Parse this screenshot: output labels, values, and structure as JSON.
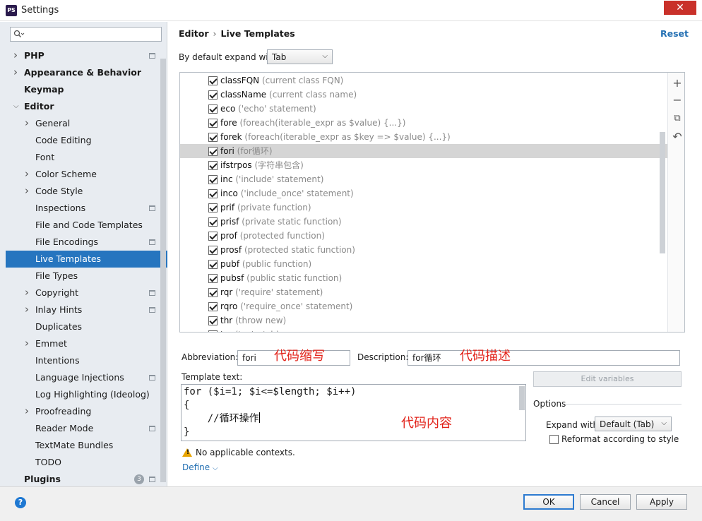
{
  "window": {
    "title": "Settings",
    "app_icon": "PS",
    "close_glyph": "✕"
  },
  "search": {
    "value": ""
  },
  "sidebar": {
    "items": [
      {
        "label": "PHP",
        "bold": true,
        "chev": true,
        "indent": 0,
        "proj": true
      },
      {
        "label": "Appearance & Behavior",
        "bold": true,
        "chev": true,
        "indent": 0
      },
      {
        "label": "Keymap",
        "bold": true,
        "chev": false,
        "indent": 0
      },
      {
        "label": "Editor",
        "bold": true,
        "chev": "open",
        "indent": 0
      },
      {
        "label": "General",
        "chev": true,
        "indent": 1
      },
      {
        "label": "Code Editing",
        "indent": 1
      },
      {
        "label": "Font",
        "indent": 1
      },
      {
        "label": "Color Scheme",
        "chev": true,
        "indent": 1
      },
      {
        "label": "Code Style",
        "chev": true,
        "indent": 1
      },
      {
        "label": "Inspections",
        "indent": 1,
        "proj": true
      },
      {
        "label": "File and Code Templates",
        "indent": 1
      },
      {
        "label": "File Encodings",
        "indent": 1,
        "proj": true
      },
      {
        "label": "Live Templates",
        "indent": 1,
        "selected": true
      },
      {
        "label": "File Types",
        "indent": 1
      },
      {
        "label": "Copyright",
        "chev": true,
        "indent": 1,
        "proj": true
      },
      {
        "label": "Inlay Hints",
        "chev": true,
        "indent": 1,
        "proj": true
      },
      {
        "label": "Duplicates",
        "indent": 1
      },
      {
        "label": "Emmet",
        "chev": true,
        "indent": 1
      },
      {
        "label": "Intentions",
        "indent": 1
      },
      {
        "label": "Language Injections",
        "indent": 1,
        "proj": true
      },
      {
        "label": "Log Highlighting (Ideolog)",
        "indent": 1
      },
      {
        "label": "Proofreading",
        "chev": true,
        "indent": 1
      },
      {
        "label": "Reader Mode",
        "indent": 1,
        "proj": true
      },
      {
        "label": "TextMate Bundles",
        "indent": 1
      },
      {
        "label": "TODO",
        "indent": 1
      },
      {
        "label": "Plugins",
        "bold": true,
        "indent": 0,
        "proj": true,
        "count": "3"
      }
    ]
  },
  "breadcrumb": {
    "parent": "Editor",
    "sep": "›",
    "current": "Live Templates"
  },
  "reset_label": "Reset",
  "expand": {
    "label": "By default expand with",
    "value": "Tab"
  },
  "templates": [
    {
      "abbr": "classFQN",
      "desc": "(current class FQN)"
    },
    {
      "abbr": "className",
      "desc": "(current class name)"
    },
    {
      "abbr": "eco",
      "desc": "('echo' statement)"
    },
    {
      "abbr": "fore",
      "desc": "(foreach(iterable_expr as $value) {...})"
    },
    {
      "abbr": "forek",
      "desc": "(foreach(iterable_expr as $key => $value) {...})"
    },
    {
      "abbr": "fori",
      "desc": "(for循环)",
      "selected": true
    },
    {
      "abbr": "ifstrpos",
      "desc": "(字符串包含)"
    },
    {
      "abbr": "inc",
      "desc": "('include' statement)"
    },
    {
      "abbr": "inco",
      "desc": "('include_once' statement)"
    },
    {
      "abbr": "prif",
      "desc": "(private function)"
    },
    {
      "abbr": "prisf",
      "desc": "(private static function)"
    },
    {
      "abbr": "prof",
      "desc": "(protected function)"
    },
    {
      "abbr": "prosf",
      "desc": "(protected static function)"
    },
    {
      "abbr": "pubf",
      "desc": "(public function)"
    },
    {
      "abbr": "pubsf",
      "desc": "(public static function)"
    },
    {
      "abbr": "rqr",
      "desc": "('require' statement)"
    },
    {
      "abbr": "rqro",
      "desc": "('require_once' statement)"
    },
    {
      "abbr": "thr",
      "desc": "(throw new)"
    },
    {
      "abbr": "try",
      "desc": "(try/catch)"
    }
  ],
  "tools": {
    "add": "+",
    "remove": "−",
    "copy": "⧉",
    "restore": "↶"
  },
  "abbreviation": {
    "label": "Abbreviation:",
    "value": "fori",
    "note": "代码缩写"
  },
  "description": {
    "label": "Description:",
    "value": "for循环",
    "note": "代码描述"
  },
  "template_text": {
    "label": "Template text:",
    "lines": [
      "for ($i=1; $i<=$length; $i++)",
      "{",
      "    //循环操作",
      "}"
    ],
    "note": "代码内容"
  },
  "edit_variables_label": "Edit variables",
  "options": {
    "title": "Options",
    "expand_with_label": "Expand with",
    "expand_with_value": "Default (Tab)",
    "reformat_label": "Reformat according to style"
  },
  "warning": {
    "text": "No applicable contexts."
  },
  "define_label": "Define",
  "buttons": {
    "ok": "OK",
    "cancel": "Cancel",
    "apply": "Apply",
    "help": "?"
  }
}
